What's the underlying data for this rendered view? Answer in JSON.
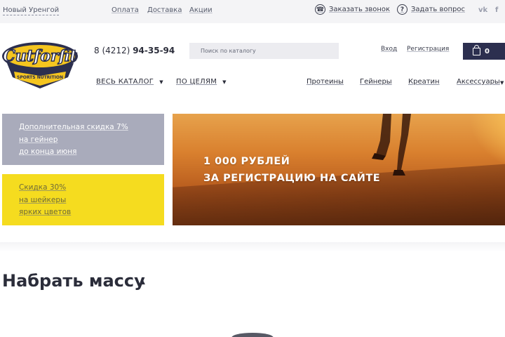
{
  "topbar": {
    "city": "Новый Уренгой",
    "nav": [
      "Оплата",
      "Доставка",
      "Акции"
    ],
    "callback": "Заказать звонок",
    "question": "Задать вопрос",
    "social": [
      "vk",
      "fb"
    ]
  },
  "header": {
    "logo_text": "Cutforfit",
    "logo_sub": "SPORTS NUTRITION",
    "phone_prefix": "8 (4212)",
    "phone_number": "94-35-94",
    "search_placeholder": "Поиск по каталогу",
    "login": "Вход",
    "register": "Регистрация",
    "cart_count": "0"
  },
  "catnav": {
    "catalog": "ВЕСЬ КАТАЛОГ",
    "goals": "ПО ЦЕЛЯМ",
    "items": [
      "Протеины",
      "Гейнеры",
      "Креатин",
      "Аксессуары"
    ]
  },
  "promos": [
    {
      "lines": [
        "Дополнительная скидка 7%",
        "на гейнер",
        "до конца июня"
      ]
    },
    {
      "lines": [
        "Скидка 30%",
        "на шейкеры",
        "ярких цветов"
      ]
    }
  ],
  "banner": {
    "line1": "1 000 РУБЛЕЙ",
    "line2": "ЗА РЕГИСТРАЦИЮ НА САЙТЕ"
  },
  "section": {
    "title": "Набрать массу"
  },
  "colors": {
    "accent_dark": "#2c2f4f",
    "promo_gray": "#a9abbb",
    "promo_yellow": "#f5dc1f"
  }
}
